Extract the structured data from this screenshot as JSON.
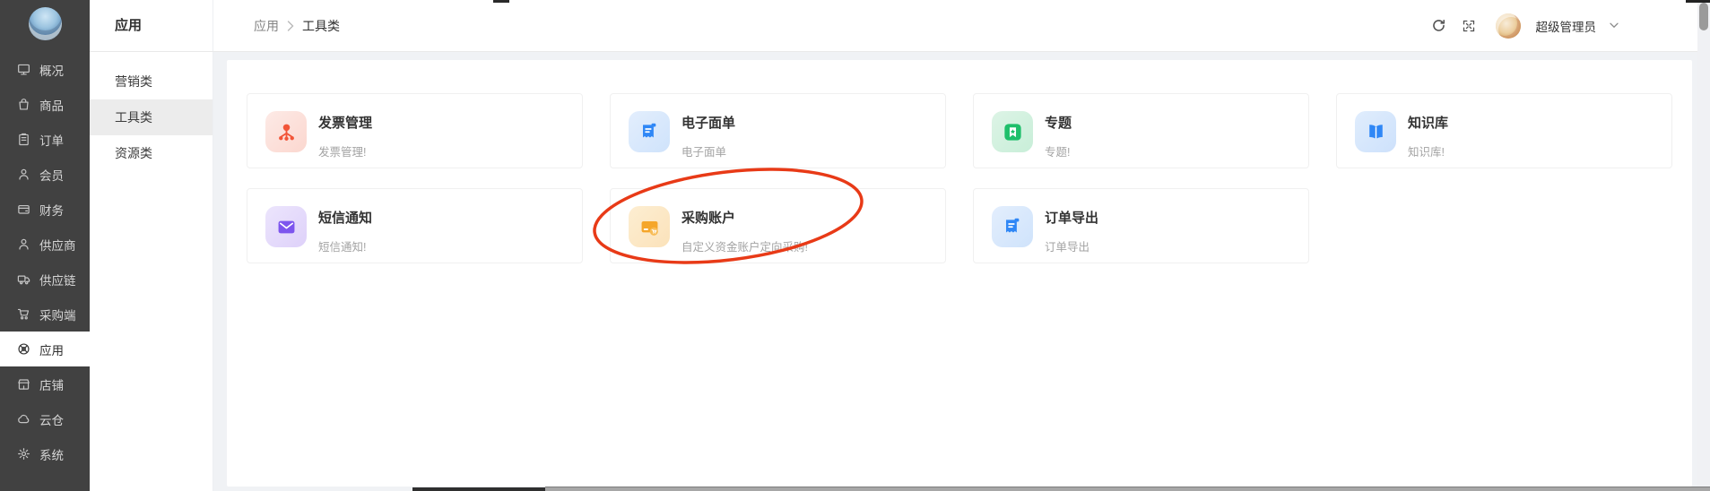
{
  "sidebar": {
    "active_label": "应用",
    "items": [
      {
        "label": "概况",
        "icon": "monitor"
      },
      {
        "label": "商品",
        "icon": "bag"
      },
      {
        "label": "订单",
        "icon": "clipboard"
      },
      {
        "label": "会员",
        "icon": "person"
      },
      {
        "label": "财务",
        "icon": "wallet"
      },
      {
        "label": "供应商",
        "icon": "person"
      },
      {
        "label": "供应链",
        "icon": "truck"
      },
      {
        "label": "采购端",
        "icon": "cart"
      },
      {
        "label": "应用",
        "icon": "apps"
      },
      {
        "label": "店铺",
        "icon": "shop"
      },
      {
        "label": "云仓",
        "icon": "cloud"
      },
      {
        "label": "系统",
        "icon": "gear"
      }
    ]
  },
  "category_panel": {
    "title": "应用",
    "selected": "工具类",
    "items": [
      "营销类",
      "工具类",
      "资源类"
    ]
  },
  "breadcrumb": {
    "items": [
      "应用",
      "工具类"
    ]
  },
  "header": {
    "user_name": "超级管理员"
  },
  "apps": [
    {
      "name": "发票管理",
      "desc": "发票管理!",
      "icon": "invoice",
      "bg": "#fdeae6",
      "bg2": "#fbd7cf",
      "fg": "#f25538"
    },
    {
      "name": "电子面单",
      "desc": "电子面单",
      "icon": "receipt",
      "bg": "#e3eefd",
      "bg2": "#cfe3fb",
      "fg": "#2f87f6"
    },
    {
      "name": "专题",
      "desc": "专题!",
      "icon": "topic",
      "bg": "#ddf4e6",
      "bg2": "#c8eed8",
      "fg": "#1fbf6b"
    },
    {
      "name": "知识库",
      "desc": "知识库!",
      "icon": "book",
      "bg": "#e0edfd",
      "bg2": "#cde1fb",
      "fg": "#2f87f6"
    },
    {
      "name": "短信通知",
      "desc": "短信通知!",
      "icon": "mail",
      "bg": "#ece5fc",
      "bg2": "#ded1fa",
      "fg": "#7d55ee"
    },
    {
      "name": "采购账户",
      "desc": "自定义资金账户定向采购!",
      "icon": "purchase",
      "bg": "#fdeed2",
      "bg2": "#fbe2ba",
      "fg": "#f5a62a"
    },
    {
      "name": "订单导出",
      "desc": "订单导出",
      "icon": "receipt",
      "bg": "#e3eefd",
      "bg2": "#cfe3fb",
      "fg": "#2f87f6"
    }
  ],
  "annotation": {
    "shape": "ellipse",
    "color": "#e83a17",
    "target": "采购账户"
  }
}
